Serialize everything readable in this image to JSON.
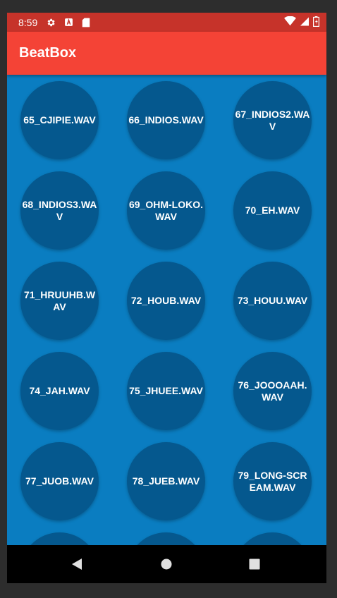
{
  "status_bar": {
    "time": "8:59",
    "left_icons": [
      "settings-gear-icon",
      "notification-a-icon",
      "sd-card-icon"
    ],
    "right_icons": [
      "wifi-icon",
      "signal-icon",
      "battery-icon"
    ]
  },
  "app_bar": {
    "title": "BeatBox"
  },
  "colors": {
    "status_bar": "#c6332a",
    "app_bar": "#f44336",
    "content_bg": "#0a7dc1",
    "button_bg": "#05588e"
  },
  "sounds": [
    "65_CJIPIE.WAV",
    "66_INDIOS.WAV",
    "67_INDIOS2.WAV",
    "68_INDIOS3.WAV",
    "69_OHM-LOKO.WAV",
    "70_EH.WAV",
    "71_HRUUHB.WAV",
    "72_HOUB.WAV",
    "73_HOUU.WAV",
    "74_JAH.WAV",
    "75_JHUEE.WAV",
    "76_JOOOAAH.WAV",
    "77_JUOB.WAV",
    "78_JUEB.WAV",
    "79_LONG-SCREAM.WAV",
    "",
    "",
    ""
  ],
  "nav": {
    "buttons": [
      "back-icon",
      "home-icon",
      "recents-icon"
    ]
  }
}
